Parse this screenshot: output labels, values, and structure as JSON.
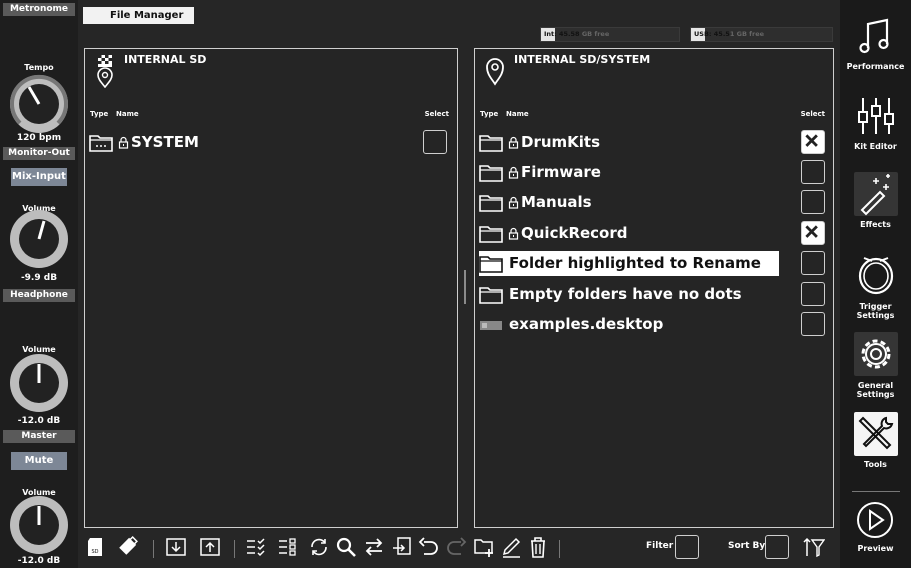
{
  "sidebar": {
    "metronome_header": "Metronome",
    "tempo_label": "Tempo",
    "tempo_value": "120 bpm",
    "monitor_header": "Monitor-Out",
    "mix_input_button": "Mix-Input",
    "monitor_volume_label": "Volume",
    "monitor_volume_value": "-9.9 dB",
    "headphone_header": "Headphone",
    "headphone_volume_label": "Volume",
    "headphone_volume_value": "-12.0 dB",
    "master_header": "Master",
    "mute_button": "Mute",
    "master_volume_label": "Volume",
    "master_volume_value": "-12.0 dB"
  },
  "header": {
    "tab_label": "File Manager",
    "storage_int_label": "Int: 45.58",
    "storage_int_suffix": " GB free",
    "storage_usb_label": "USB: 45.5",
    "storage_usb_suffix": "1 GB free",
    "storage_int_fill": 0.1,
    "storage_usb_fill": 0.1
  },
  "left_panel": {
    "title": "INTERNAL SD",
    "col_type": "Type",
    "col_name": "Name",
    "col_select": "Select",
    "items": [
      {
        "name": "SYSTEM",
        "locked": true
      }
    ]
  },
  "right_panel": {
    "title": "INTERNAL SD/SYSTEM",
    "col_type": "Type",
    "col_name": "Name",
    "col_select": "Select",
    "items": [
      {
        "name": "DrumKits",
        "locked": true,
        "checked": true
      },
      {
        "name": "Firmware",
        "locked": true,
        "checked": false
      },
      {
        "name": "Manuals",
        "locked": true,
        "checked": false
      },
      {
        "name": "QuickRecord",
        "locked": true,
        "checked": true
      },
      {
        "name": "Folder highlighted to Rename",
        "locked": false,
        "checked": false,
        "highlighted": true
      },
      {
        "name": "Empty folders have no dots",
        "locked": false,
        "checked": false
      },
      {
        "name": "examples.desktop",
        "locked": false,
        "checked": false,
        "file": true
      }
    ]
  },
  "toolbar": {
    "filter_label": "Filter",
    "sort_label": "Sort By"
  },
  "nav": {
    "performance": "Performance",
    "kit_editor": "Kit Editor",
    "effects": "Effects",
    "trigger_settings": "Trigger Settings",
    "general_settings": "General Settings",
    "tools": "Tools",
    "preview": "Preview"
  },
  "colors": {
    "background": "#262626",
    "accent_button": "#7d8796",
    "panel_border": "#cfcfcf"
  }
}
